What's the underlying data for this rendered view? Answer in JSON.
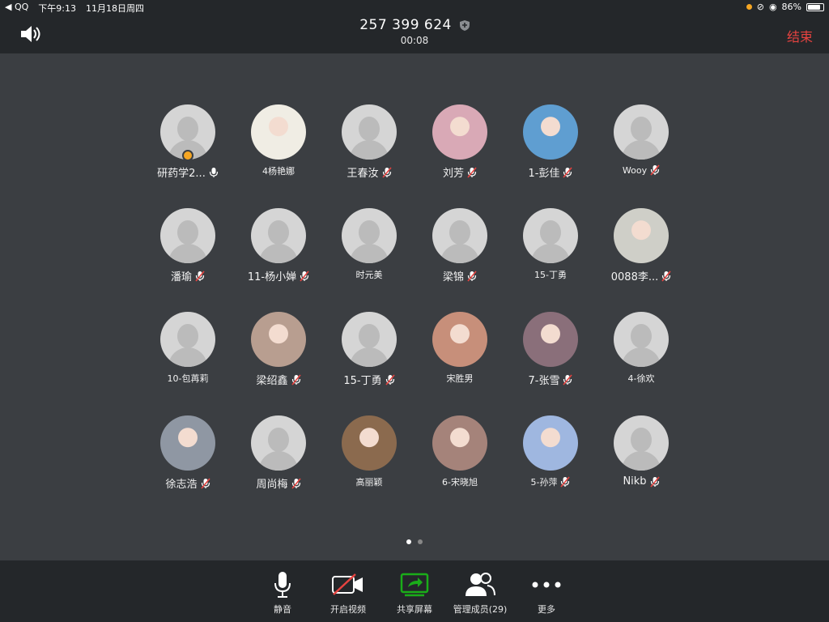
{
  "status": {
    "carrier": "◀ QQ",
    "time": "下午9:13",
    "date": "11月18日周四",
    "battery": "86%",
    "battery_level": 0.86
  },
  "header": {
    "meeting_id": "257 399 624",
    "timer": "00:08",
    "end_label": "结束"
  },
  "participants": [
    {
      "name": "研药学2...",
      "mic": "on",
      "host": true,
      "photo": false
    },
    {
      "name": "4杨艳娜",
      "mic": "none",
      "photo": true,
      "color": "#f0ede4",
      "small": true
    },
    {
      "name": "王春汝",
      "mic": "off",
      "photo": false
    },
    {
      "name": "刘芳",
      "mic": "off",
      "photo": true,
      "color": "#d9a9b6"
    },
    {
      "name": "1-彭佳",
      "mic": "off",
      "photo": true,
      "color": "#5f9ed1"
    },
    {
      "name": "Wooy",
      "mic": "off",
      "photo": false,
      "small": true
    },
    {
      "name": "潘瑜",
      "mic": "off",
      "photo": false
    },
    {
      "name": "11-杨小婵",
      "mic": "off",
      "photo": false
    },
    {
      "name": "时元美",
      "mic": "none",
      "photo": false,
      "small": true
    },
    {
      "name": "梁锦",
      "mic": "off",
      "photo": false
    },
    {
      "name": "15-丁勇",
      "mic": "none",
      "photo": false,
      "small": true
    },
    {
      "name": "0088李...",
      "mic": "off",
      "photo": true,
      "color": "#cfcfc8"
    },
    {
      "name": "10-包苒莉",
      "mic": "none",
      "photo": false,
      "small": true
    },
    {
      "name": "梁绍鑫",
      "mic": "off",
      "photo": true,
      "color": "#b89e90"
    },
    {
      "name": "15-丁勇",
      "mic": "off",
      "photo": false
    },
    {
      "name": "宋胜男",
      "mic": "none",
      "photo": true,
      "color": "#c78f7a",
      "small": true
    },
    {
      "name": "7-张雪",
      "mic": "off",
      "photo": true,
      "color": "#8a6f7a"
    },
    {
      "name": "4-徐欢",
      "mic": "none",
      "photo": false,
      "small": true
    },
    {
      "name": "徐志浩",
      "mic": "off",
      "photo": true,
      "color": "#8f97a3"
    },
    {
      "name": "周尚梅",
      "mic": "off",
      "photo": false
    },
    {
      "name": "高丽颖",
      "mic": "none",
      "photo": true,
      "color": "#8b6a4e",
      "small": true
    },
    {
      "name": "6-宋晓旭",
      "mic": "none",
      "photo": true,
      "color": "#a5837a",
      "small": true
    },
    {
      "name": "5-孙萍",
      "mic": "off",
      "photo": true,
      "color": "#9fb7e0",
      "small": true
    },
    {
      "name": "Nikb",
      "mic": "off",
      "photo": false
    }
  ],
  "pager": {
    "pages": 2,
    "current": 1
  },
  "toolbar": {
    "mute": "静音",
    "video": "开启视频",
    "share": "共享屏幕",
    "members": "管理成员(29)",
    "more": "更多"
  },
  "colors": {
    "accent_green": "#1aad19",
    "end_red": "#e64340",
    "host_badge": "#f5a623",
    "mic_off_red": "#e64340"
  },
  "icons": {
    "speaker": "speaker-icon",
    "shield": "shield-icon",
    "mic": "mic-icon",
    "mic_off": "mic-off-icon",
    "video_off": "video-off-icon",
    "share": "share-screen-icon",
    "members": "members-icon",
    "more": "more-icon"
  }
}
